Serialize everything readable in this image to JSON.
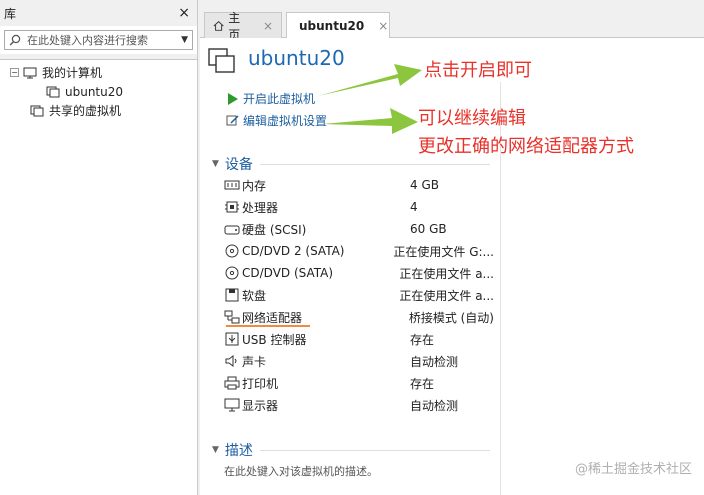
{
  "library": {
    "title": "库",
    "close": "×",
    "search_placeholder": "在此处键入内容进行搜索",
    "tree": {
      "my_computer": "我的计算机",
      "vm": "ubuntu20",
      "shared": "共享的虚拟机"
    }
  },
  "tabs": [
    {
      "label": "主页",
      "close": "×"
    },
    {
      "label": "ubuntu20",
      "close": "×"
    }
  ],
  "vm": {
    "name": "ubuntu20",
    "actions": {
      "power_on": "开启此虚拟机",
      "edit_settings": "编辑虚拟机设置"
    }
  },
  "devices": {
    "header": "设备",
    "items": [
      {
        "name": "内存",
        "value": "4 GB",
        "icon": "memory-icon"
      },
      {
        "name": "处理器",
        "value": "4",
        "icon": "cpu-icon"
      },
      {
        "name": "硬盘 (SCSI)",
        "value": "60 GB",
        "icon": "harddisk-icon"
      },
      {
        "name": "CD/DVD 2 (SATA)",
        "value": "正在使用文件 G:...",
        "icon": "cd-icon"
      },
      {
        "name": "CD/DVD (SATA)",
        "value": "正在使用文件 a...",
        "icon": "cd-icon"
      },
      {
        "name": "软盘",
        "value": "正在使用文件 a...",
        "icon": "floppy-icon"
      },
      {
        "name": "网络适配器",
        "value": "桥接模式 (自动)",
        "icon": "network-icon"
      },
      {
        "name": "USB 控制器",
        "value": "存在",
        "icon": "usb-icon"
      },
      {
        "name": "声卡",
        "value": "自动检测",
        "icon": "speaker-icon"
      },
      {
        "name": "打印机",
        "value": "存在",
        "icon": "printer-icon"
      },
      {
        "name": "显示器",
        "value": "自动检测",
        "icon": "monitor-icon"
      }
    ]
  },
  "description": {
    "header": "描述",
    "placeholder": "在此处键入对该虚拟机的描述。"
  },
  "annotations": {
    "power_on_note": "点击开启即可",
    "edit_note_line1": "可以继续编辑",
    "edit_note_line2": "更改正确的网络适配器方式"
  },
  "watermark": "@稀土掘金技术社区",
  "colors": {
    "link": "#1c5fa0",
    "title": "#1c68b4",
    "annotation": "#e8312a",
    "arrow": "#8cc63f",
    "highlight": "#f08a3c"
  }
}
